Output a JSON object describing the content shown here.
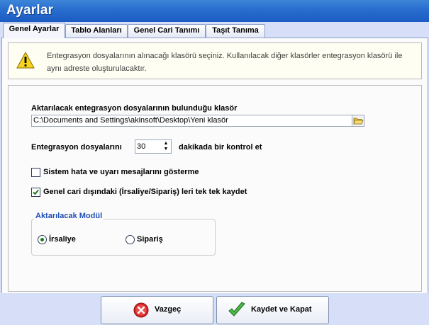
{
  "window": {
    "title": "Ayarlar"
  },
  "tabs": [
    {
      "label": "Genel Ayarlar",
      "active": true
    },
    {
      "label": "Tablo Alanları",
      "active": false
    },
    {
      "label": "Genel Cari Tanımı",
      "active": false
    },
    {
      "label": "Taşıt Tanıma",
      "active": false
    }
  ],
  "warning": {
    "icon": "warning-triangle-icon",
    "text": "Entegrasyon dosyalarının alınacağı klasörü seçiniz. Kullanılacak diğer klasörler entegrasyon klasörü ile aynı adreste oluşturulacaktır."
  },
  "folder": {
    "label": "Aktarılacak entegrasyon dosyalarının bulunduğu klasör",
    "path": "C:\\Documents and Settings\\akinsoft\\Desktop\\Yeni klasör",
    "browse_icon": "folder-open-icon"
  },
  "interval": {
    "prefix": "Entegrasyon dosyalarını",
    "value": "30",
    "suffix": "dakikada bir kontrol et"
  },
  "options": [
    {
      "label": "Sistem hata ve uyarı mesajlarını gösterme",
      "checked": false
    },
    {
      "label": "Genel cari dışındaki (İrsaliye/Sipariş) leri tek tek kaydet",
      "checked": true
    }
  ],
  "module_group": {
    "title": "Aktarılacak Modül",
    "options": [
      {
        "label": "İrsaliye",
        "selected": true
      },
      {
        "label": "Sipariş",
        "selected": false
      }
    ]
  },
  "footer": {
    "cancel_label": "Vazgeç",
    "save_label": "Kaydet ve Kapat",
    "cancel_icon": "cancel-x-icon",
    "save_icon": "checkmark-icon"
  },
  "colors": {
    "title_bar": "#2a6fd0",
    "accent_green": "#1a7a1a",
    "group_title": "#1f4fb5"
  }
}
